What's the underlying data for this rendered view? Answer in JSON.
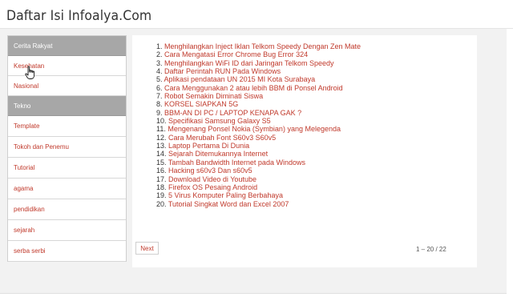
{
  "header": {
    "title": "Daftar Isi Infoalya.Com"
  },
  "sidebar": {
    "items": [
      {
        "label": "Cerita Rakyat",
        "type": "header"
      },
      {
        "label": "Kesehatan",
        "type": "link"
      },
      {
        "label": "Nasional",
        "type": "link"
      },
      {
        "label": "Tekno",
        "type": "header"
      },
      {
        "label": "Template",
        "type": "link"
      },
      {
        "label": "Tokoh dan Penemu",
        "type": "link"
      },
      {
        "label": "Tutorial",
        "type": "link"
      },
      {
        "label": "agama",
        "type": "link"
      },
      {
        "label": "pendidikan",
        "type": "link"
      },
      {
        "label": "sejarah",
        "type": "link"
      },
      {
        "label": "serba serbi",
        "type": "link"
      }
    ]
  },
  "posts": [
    {
      "num": "1.",
      "title": "Menghilangkan Inject Iklan Telkom Speedy Dengan Zen Mate"
    },
    {
      "num": "2.",
      "title": "Cara Mengatasi Error Chrome Bug Error 324"
    },
    {
      "num": "3.",
      "title": "Menghilangkan WiFi ID dari Jaringan Telkom Speedy"
    },
    {
      "num": "4.",
      "title": "Daftar Perintah RUN Pada Windows"
    },
    {
      "num": "5.",
      "title": "Aplikasi pendataan UN 2015 MI Kota Surabaya"
    },
    {
      "num": "6.",
      "title": "Cara Menggunakan 2 atau lebih BBM di Ponsel Android"
    },
    {
      "num": "7.",
      "title": "Robot Semakin Diminati Siswa"
    },
    {
      "num": "8.",
      "title": "KORSEL SIAPKAN 5G"
    },
    {
      "num": "9.",
      "title": "BBM-AN DI PC / LAPTOP KENAPA GAK ?"
    },
    {
      "num": "10.",
      "title": "Specifikasi Samsung Galaxy S5"
    },
    {
      "num": "11.",
      "title": "Mengenang Ponsel Nokia (Symbian) yang Melegenda"
    },
    {
      "num": "12.",
      "title": "Cara Merubah Font S60v3 S60v5"
    },
    {
      "num": "13.",
      "title": "Laptop Pertama Di Dunia"
    },
    {
      "num": "14.",
      "title": "Sejarah Ditemukannya Internet"
    },
    {
      "num": "15.",
      "title": "Tambah Bandwidth Internet pada Windows"
    },
    {
      "num": "16.",
      "title": "Hacking s60v3 Dan s60v5"
    },
    {
      "num": "17.",
      "title": "Download Video di Youtube"
    },
    {
      "num": "18.",
      "title": "Firefox OS Pesaing Android"
    },
    {
      "num": "19.",
      "title": "5 Virus Komputer Paling Berbahaya"
    },
    {
      "num": "20.",
      "title": "Tutorial Singkat Word dan Excel 2007"
    }
  ],
  "pagination": {
    "next_label": "Next",
    "range": "1 – 20 / 22"
  },
  "icons": {
    "cursor": "hand-pointer-icon"
  },
  "colors": {
    "link": "#c0392b",
    "sidebar_header_bg": "#a7a7a7",
    "panel_bg": "#f2f2f2"
  }
}
